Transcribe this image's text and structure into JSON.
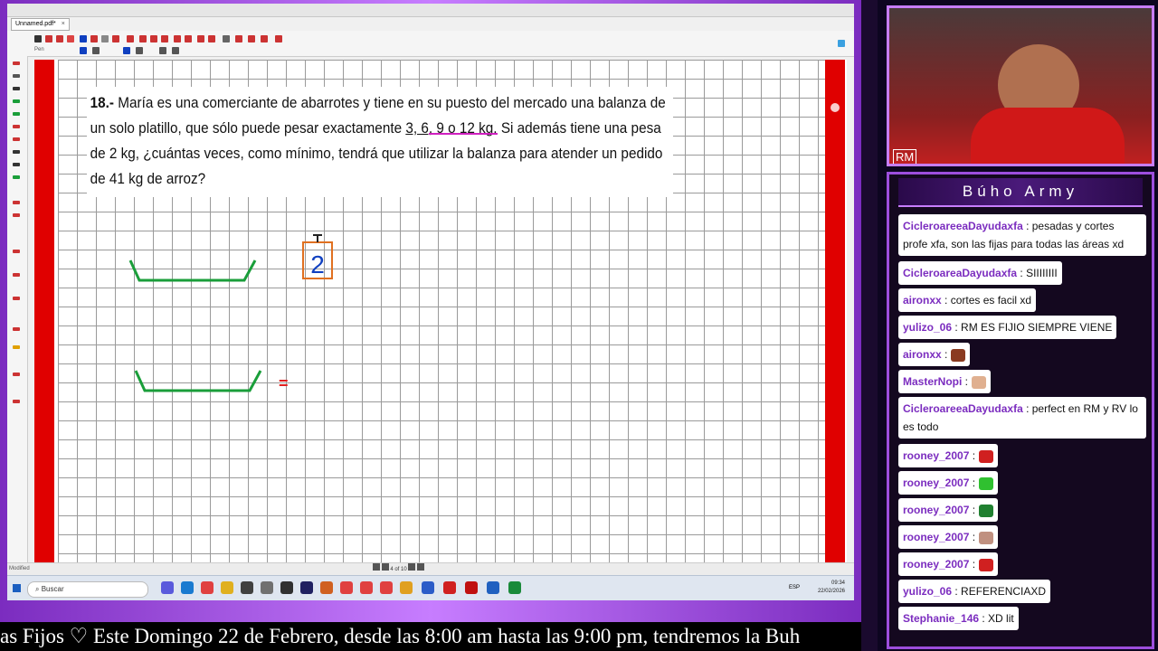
{
  "app": {
    "tab_title": "Unnamed.pdf*",
    "tab_close": "×",
    "toolbar_label": "Pen"
  },
  "document": {
    "problem_number": "18.-",
    "problem_text_1": "María es una comerciante de abarrotes y tiene en su puesto del mercado una balanza de un solo platillo, que sólo puede pesar exactamente ",
    "problem_underlined": "3, 6, 9 o 12 kg",
    "problem_text_2": ". Si además tiene una pesa de 2 kg, ¿cuántas veces, como mínimo, tendrá que utilizar la balanza para atender un pedido de 41 kg de arroz?",
    "weight_value": "2",
    "equals_sign": "="
  },
  "statusbar": {
    "left_text": "Modified",
    "page_indicator": "4 of 10"
  },
  "taskbar": {
    "search_placeholder": "Buscar",
    "time": "09:34",
    "date": "22/02/2026",
    "lang": "ESP"
  },
  "ticker": {
    "text": "as Fijos ♡     Este Domingo 22 de Febrero, desde las 8:00 am hasta las 9:00 pm, tendremos la Buh"
  },
  "camera": {
    "label": "RM"
  },
  "chat": {
    "title": "Búho Army",
    "messages": [
      {
        "user": "CicleroareeaDayudaxfa",
        "text": ": pesadas y cortes profe xfa, son las fijas para todas las áreas xd"
      },
      {
        "user": "CicleroareaDayudaxfa",
        "text": ": SIIIIIIII"
      },
      {
        "user": "aironxx",
        "text": ": cortes es facil xd"
      },
      {
        "user": "yulizo_06",
        "text": ": RM ES FIJIO SIEMPRE VIENE"
      },
      {
        "user": "aironxx",
        "text": ":"
      },
      {
        "user": "MasterNopi",
        "text": ":"
      },
      {
        "user": "CicleroareeaDayudaxfa",
        "text": ": perfect en RM y RV lo es todo"
      },
      {
        "user": "rooney_2007",
        "text": ":"
      },
      {
        "user": "rooney_2007",
        "text": ":"
      },
      {
        "user": "rooney_2007",
        "text": ":"
      },
      {
        "user": "rooney_2007",
        "text": ":"
      },
      {
        "user": "rooney_2007",
        "text": ":"
      },
      {
        "user": "yulizo_06",
        "text": ": REFERENCIAXD"
      },
      {
        "user": "Stephanie_146",
        "text": ": XD lit"
      }
    ]
  },
  "colors": {
    "accent_purple": "#c77dff",
    "red_margin": "#e00000",
    "pen_green": "#1a9e3a",
    "pen_blue": "#1040c0",
    "box_orange": "#e07020"
  }
}
